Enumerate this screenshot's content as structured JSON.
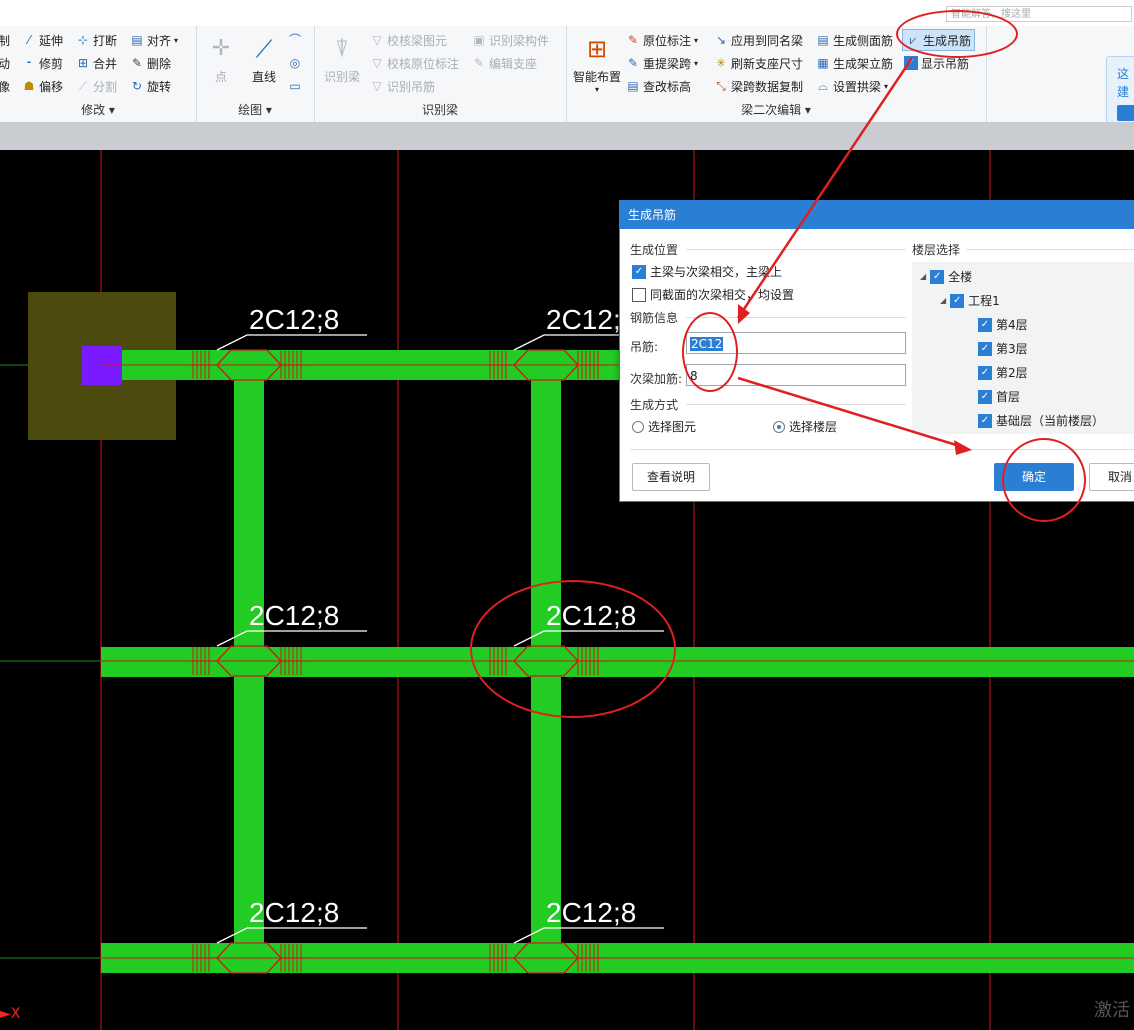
{
  "topbar": {
    "search_placeholder": "智能解答，搜这里"
  },
  "ribbon": {
    "modify": {
      "label": "修改",
      "items": [
        {
          "label": "制",
          "icon": "copy-icon"
        },
        {
          "label": "延伸",
          "icon": "extend-icon"
        },
        {
          "label": "打断",
          "icon": "break-icon"
        },
        {
          "label": "对齐",
          "icon": "align-icon"
        },
        {
          "label": "动",
          "icon": "move-icon"
        },
        {
          "label": "修剪",
          "icon": "trim-icon"
        },
        {
          "label": "合并",
          "icon": "merge-icon"
        },
        {
          "label": "删除",
          "icon": "delete-icon"
        },
        {
          "label": "像",
          "icon": "mirror-icon"
        },
        {
          "label": "偏移",
          "icon": "offset-icon"
        },
        {
          "label": "分割",
          "icon": "split-icon"
        },
        {
          "label": "旋转",
          "icon": "rotate-icon"
        }
      ]
    },
    "draw": {
      "label": "绘图",
      "point": "点",
      "line": "直线"
    },
    "identify": {
      "label": "识别梁",
      "identify_beam": "识别梁",
      "check_beam_elements": "校核梁图元",
      "check_original_annotation": "校核原位标注",
      "identify_rebar_hanger": "识别吊筋",
      "identify_beam_component": "识别梁构件",
      "edit_support": "编辑支座"
    },
    "secondary": {
      "label": "梁二次编辑",
      "smart_layout": "智能布置",
      "original_annotation": "原位标注",
      "reextract_span": "重提梁跨",
      "change_elevation": "查改标高",
      "apply_same_name": "应用到同名梁",
      "refresh_support_size": "刷新支座尺寸",
      "copy_span_data": "梁跨数据复制",
      "gen_side_rebar": "生成侧面筋",
      "gen_stand_rebar": "生成架立筋",
      "set_arch_beam": "设置拱梁",
      "gen_hanger": "生成吊筋",
      "show_hanger": "显示吊筋"
    },
    "notif": {
      "line1": "这",
      "line2": "建"
    }
  },
  "cad": {
    "labels": [
      "2C12;8",
      "2C12;8",
      "2C12;8",
      "2C12;8",
      "2C12;8",
      "2C12;8"
    ]
  },
  "dialog": {
    "title": "生成吊筋",
    "position_section": "生成位置",
    "opt_main_secondary": "主梁与次梁相交，主梁上",
    "opt_same_section": "同截面的次梁相交，均设置",
    "rebar_section": "钢筋信息",
    "hanger_label": "吊筋:",
    "hanger_value": "2C12",
    "stirrup_label": "次梁加筋:",
    "stirrup_value": "8",
    "method_section": "生成方式",
    "method_select_element": "选择图元",
    "method_select_floor": "选择楼层",
    "view_help": "查看说明",
    "ok": "确定",
    "cancel": "取消",
    "floor_section": "楼层选择",
    "tree": [
      "全楼",
      "工程1",
      "第4层",
      "第3层",
      "第2层",
      "首层",
      "基础层（当前楼层）"
    ]
  },
  "watermark": "激活",
  "axis_x": "X"
}
